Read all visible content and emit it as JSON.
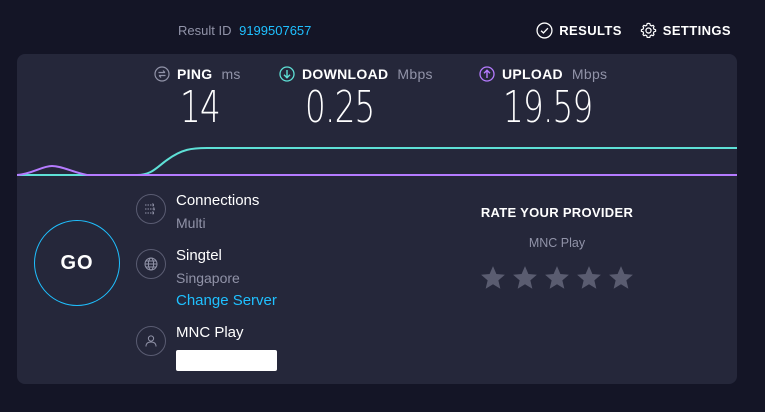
{
  "header": {
    "result_label": "Result ID",
    "result_id": "9199507657",
    "results_label": "RESULTS",
    "settings_label": "SETTINGS"
  },
  "metrics": {
    "ping": {
      "label": "PING",
      "unit": "ms",
      "value": "14"
    },
    "download": {
      "label": "DOWNLOAD",
      "unit": "Mbps",
      "value": "0.25"
    },
    "upload": {
      "label": "UPLOAD",
      "unit": "Mbps",
      "value": "19.59"
    }
  },
  "go_label": "GO",
  "connections": {
    "title": "Connections",
    "value": "Multi"
  },
  "server": {
    "name": "Singtel",
    "location": "Singapore",
    "change_label": "Change Server"
  },
  "isp": {
    "name": "MNC Play"
  },
  "rate": {
    "title": "RATE YOUR PROVIDER",
    "isp": "MNC Play",
    "stars": 5,
    "selected": 0
  },
  "colors": {
    "background": "#141526",
    "panel": "#25273a",
    "accent": "#1fc0ff",
    "download": "#5ee0d6",
    "upload": "#b57bff",
    "muted": "#9193a8",
    "star": "#5a5c70"
  },
  "icons": {
    "results": "check-circle-icon",
    "settings": "gear-icon",
    "ping": "ping-icon",
    "download": "download-arrow-icon",
    "upload": "upload-arrow-icon",
    "connections": "connections-icon",
    "server": "globe-icon",
    "isp": "user-icon",
    "rating": "star-icon"
  }
}
